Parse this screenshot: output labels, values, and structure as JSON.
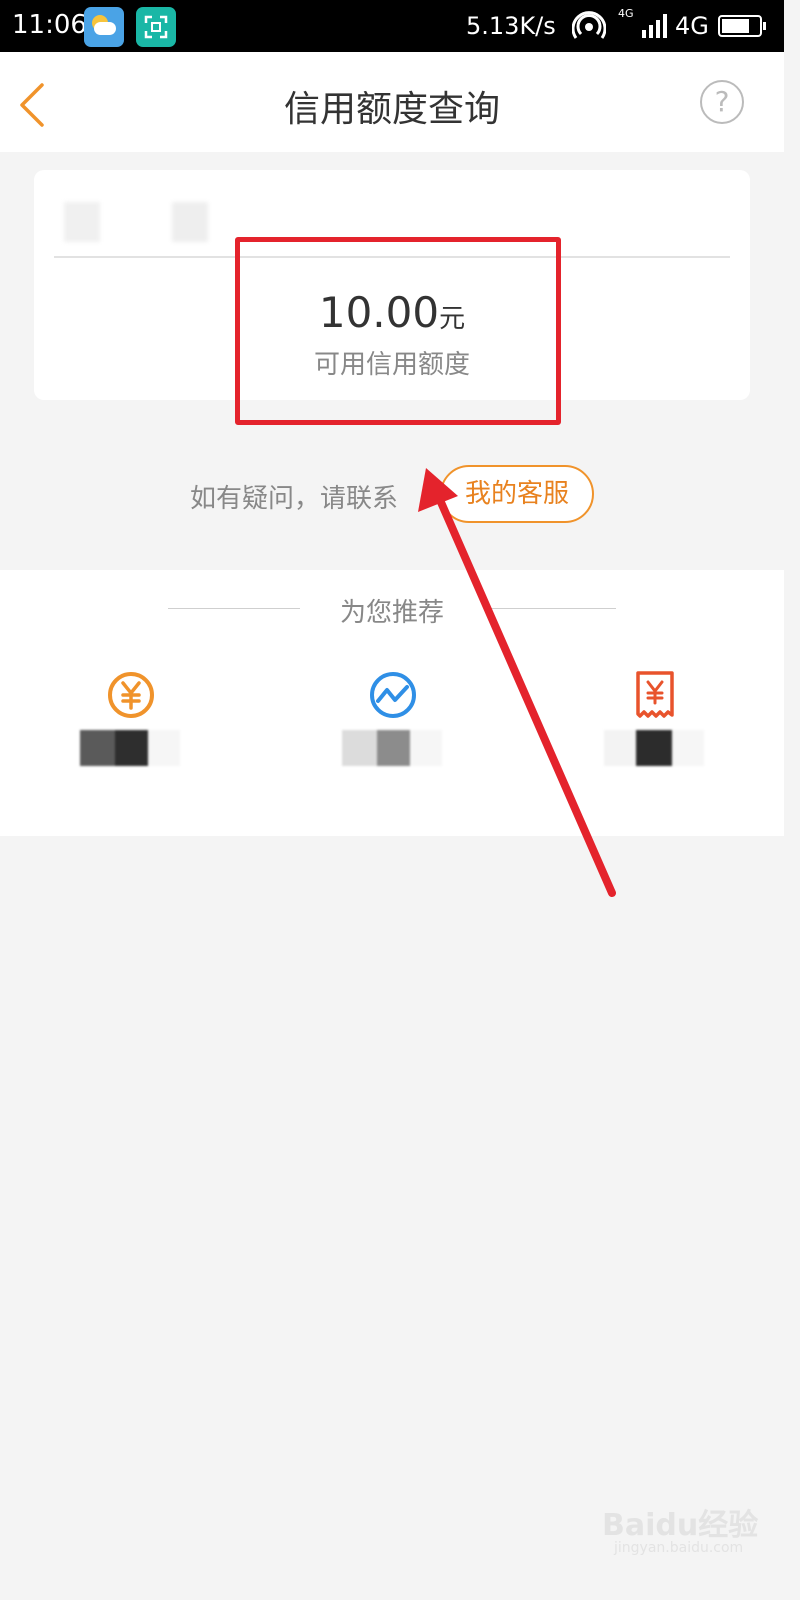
{
  "status_bar": {
    "time": "11:06",
    "net_speed": "5.13K/s",
    "network_small": "4G",
    "network": "4G",
    "battery_level": 0.75
  },
  "header": {
    "title": "信用额度查询"
  },
  "credit": {
    "amount": "10.00",
    "unit": "元",
    "label": "可用信用额度"
  },
  "contact": {
    "text": "如有疑问，请联系",
    "service_button": "我的客服"
  },
  "recommend": {
    "title": "为您推荐",
    "items": [
      {
        "icon": "yuan-coin-icon",
        "color": "#f0932b"
      },
      {
        "icon": "trend-chart-icon",
        "color": "#2f8fe6"
      },
      {
        "icon": "yuan-receipt-icon",
        "color": "#e8532c"
      }
    ]
  },
  "watermark": {
    "text": "Baidu经验",
    "sub": "jingyan.baidu.com"
  },
  "colors": {
    "accent": "#f0932b",
    "highlight": "#e4232c"
  }
}
